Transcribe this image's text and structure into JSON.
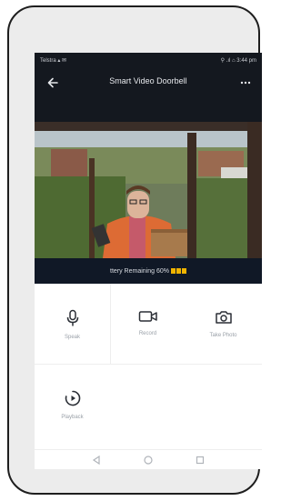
{
  "status_bar": {
    "left": "Telstra ▴ ✉",
    "right": "⚲ .ıl ⌂ 3:44 pm"
  },
  "header": {
    "title": "Smart Video Doorbell"
  },
  "video_info": {
    "battery_text": "ttery Remaining  60%"
  },
  "controls": [
    {
      "label": "Speak",
      "icon": "microphone-icon"
    },
    {
      "label": "Record",
      "icon": "video-camera-icon"
    },
    {
      "label": "Take Photo",
      "icon": "camera-icon"
    },
    {
      "label": "Playback",
      "icon": "playback-icon"
    }
  ],
  "colors": {
    "header_bg": "#14181f",
    "battery": "#f0b400",
    "icon_dark": "#2b2f36"
  }
}
